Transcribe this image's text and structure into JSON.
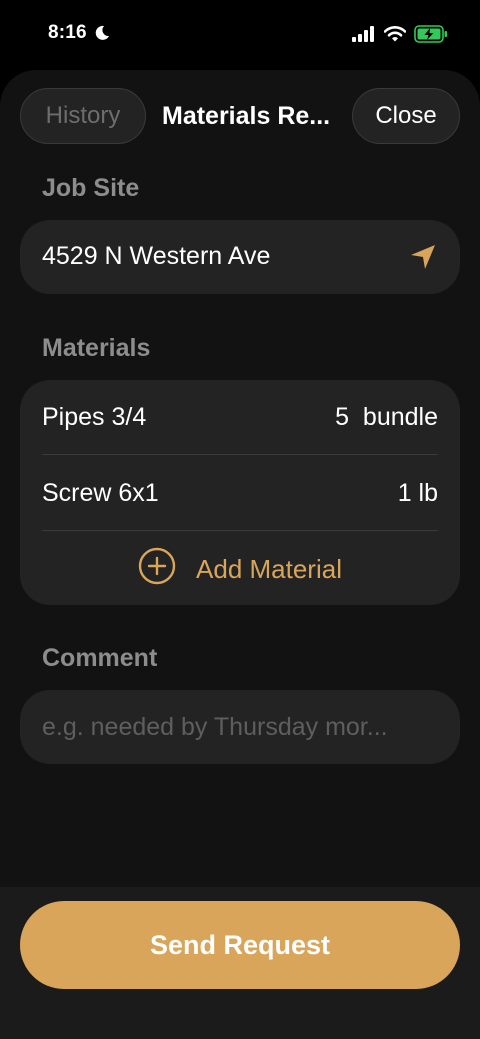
{
  "status_bar": {
    "time": "8:16"
  },
  "header": {
    "history_label": "History",
    "title": "Materials Re...",
    "close_label": "Close"
  },
  "job_site": {
    "label": "Job Site",
    "address": "4529 N Western Ave"
  },
  "materials": {
    "label": "Materials",
    "items": [
      {
        "name": "Pipes 3/4",
        "quantity": "5  bundle"
      },
      {
        "name": "Screw 6x1",
        "quantity": "1 lb"
      }
    ],
    "add_label": "Add Material"
  },
  "comment": {
    "label": "Comment",
    "placeholder": "e.g. needed by Thursday mor...",
    "value": ""
  },
  "send_label": "Send Request",
  "colors": {
    "accent": "#d9a55a",
    "battery": "#34c759"
  },
  "icons": [
    "moon-icon",
    "signal-icon",
    "wifi-icon",
    "battery-icon",
    "location-arrow-icon",
    "plus-circle-icon"
  ]
}
